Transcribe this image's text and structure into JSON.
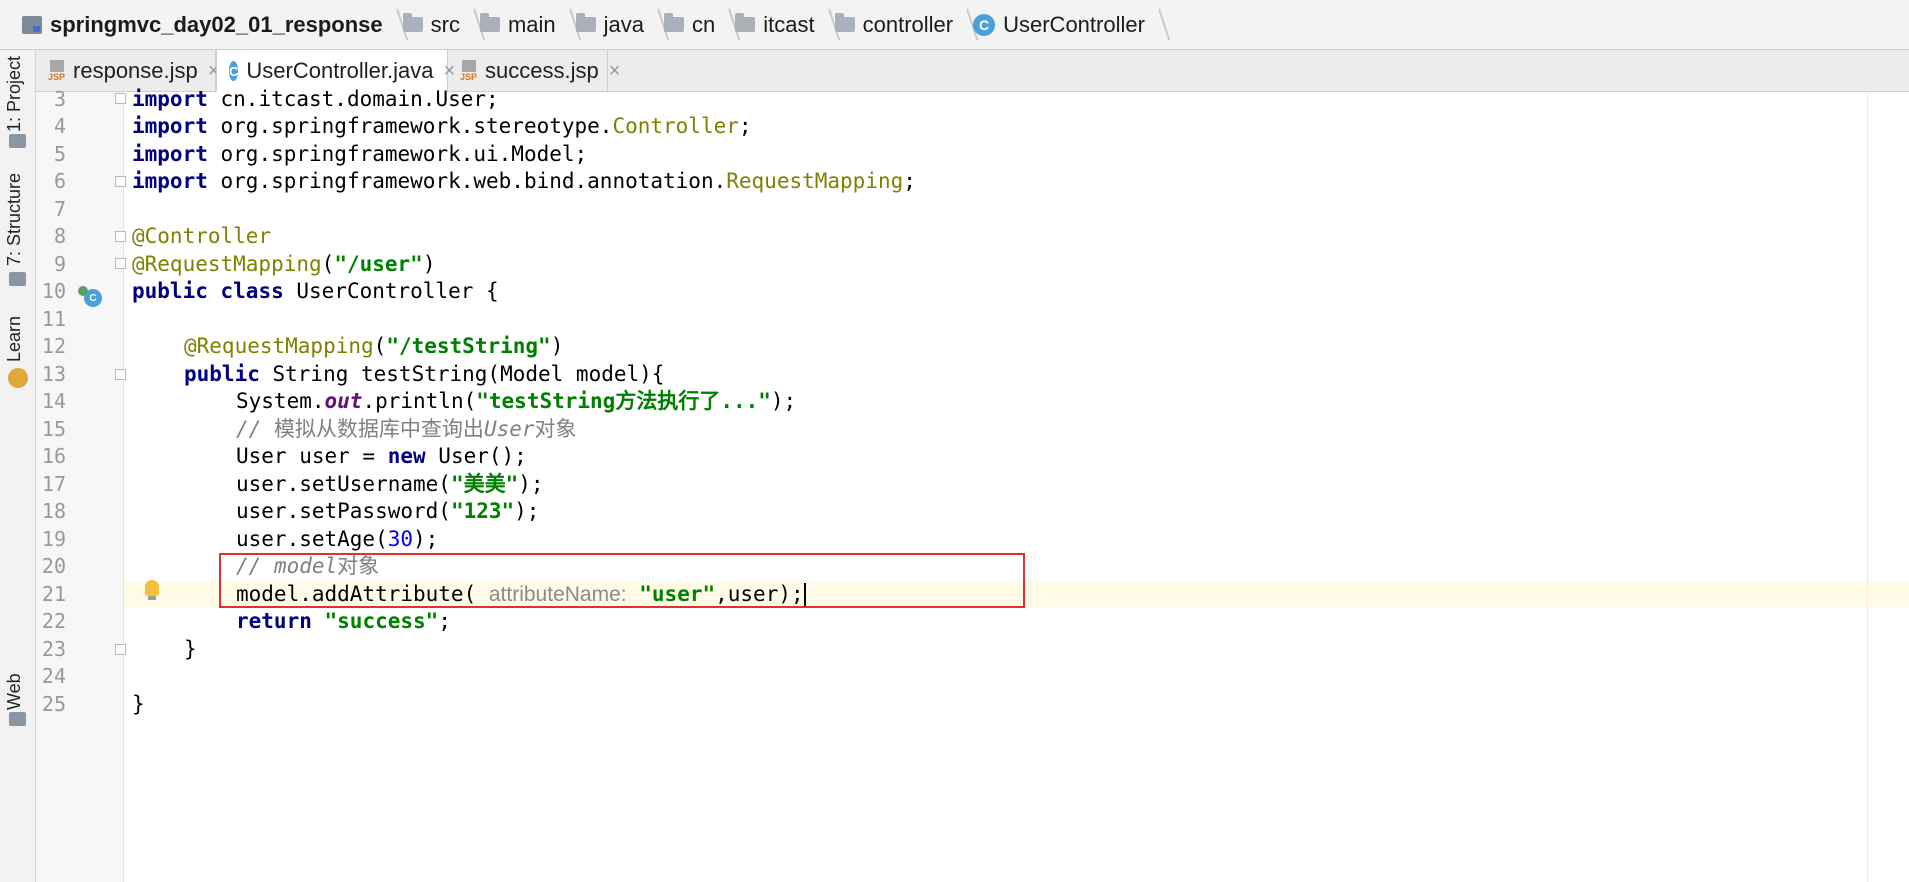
{
  "breadcrumb": [
    {
      "label": "springmvc_day02_01_response",
      "icon": "module-icon",
      "bold": true
    },
    {
      "label": "src",
      "icon": "folder-icon"
    },
    {
      "label": "main",
      "icon": "folder-icon"
    },
    {
      "label": "java",
      "icon": "folder-icon"
    },
    {
      "label": "cn",
      "icon": "folder-icon"
    },
    {
      "label": "itcast",
      "icon": "folder-icon"
    },
    {
      "label": "controller",
      "icon": "folder-icon"
    },
    {
      "label": "UserController",
      "icon": "class-icon"
    }
  ],
  "left_tools": {
    "project": "1: Project",
    "structure": "7: Structure",
    "learn": "Learn",
    "web": "Web"
  },
  "tabs": [
    {
      "label": "response.jsp",
      "close": "×",
      "icon": "jsp-file-icon"
    },
    {
      "label": "UserController.java",
      "close": "×",
      "icon": "class-icon",
      "active": true
    },
    {
      "label": "success.jsp",
      "close": "×",
      "icon": "jsp-file-icon"
    }
  ],
  "icons": {
    "jsp_label": "JSP",
    "class_letter": "C"
  },
  "editor": {
    "hint_param": "attributeName:",
    "highlight_color": "#e0302f",
    "lines": [
      {
        "n": "3"
      },
      {
        "n": "4"
      },
      {
        "n": "5"
      },
      {
        "n": "6"
      },
      {
        "n": "7"
      },
      {
        "n": "8"
      },
      {
        "n": "9"
      },
      {
        "n": "10"
      },
      {
        "n": "11"
      },
      {
        "n": "12"
      },
      {
        "n": "13"
      },
      {
        "n": "14"
      },
      {
        "n": "15"
      },
      {
        "n": "16"
      },
      {
        "n": "17"
      },
      {
        "n": "18"
      },
      {
        "n": "19"
      },
      {
        "n": "20"
      },
      {
        "n": "21"
      },
      {
        "n": "22"
      },
      {
        "n": "23"
      },
      {
        "n": "24"
      },
      {
        "n": "25"
      }
    ],
    "tokens": {
      "import": "import",
      "l3": "cn.itcast.domain.User;",
      "l4a": "org.springframework.stereotype.",
      "l4b": "Controller",
      "semi": ";",
      "l5": "org.springframework.ui.Model;",
      "l6a": "org.springframework.web.bind.annotation.",
      "l6b": "RequestMapping",
      "l8": "@Controller",
      "l9a": "@RequestMapping",
      "l9b": "(",
      "l9s": "\"/user\"",
      "l9c": ")",
      "public": "public",
      "class": "class",
      "l10": " UserController {",
      "l12a": "@RequestMapping",
      "l12b": "(",
      "l12s": "\"/testString\"",
      "l12c": ")",
      "l13": " String testString(Model model){",
      "l14a": "System.",
      "l14b": "out",
      "l14c": ".println(",
      "l14s": "\"testString方法执行了...\"",
      "l14d": ");",
      "l15a": "// ",
      "l15b": "模拟从数据库中查询出",
      "l15c": "User",
      "l15d": "对象",
      "l16a": "User user = ",
      "new": "new",
      "l16b": " User();",
      "l17a": "user.setUsername(",
      "l17s": "\"美美\"",
      "l17b": ");",
      "l18a": "user.setPassword(",
      "l18s": "\"123\"",
      "l18b": ");",
      "l19a": "user.setAge(",
      "l19n": "30",
      "l19b": ");",
      "l20a": "// ",
      "l20b": "model",
      "l20c": "对象",
      "l21a": "model.addAttribute( ",
      "l21s": "\"user\"",
      "l21b": ",user);",
      "return": "return",
      "l22s": "\"success\"",
      "l22b": ";",
      "l23": "}",
      "l25": "}"
    }
  }
}
